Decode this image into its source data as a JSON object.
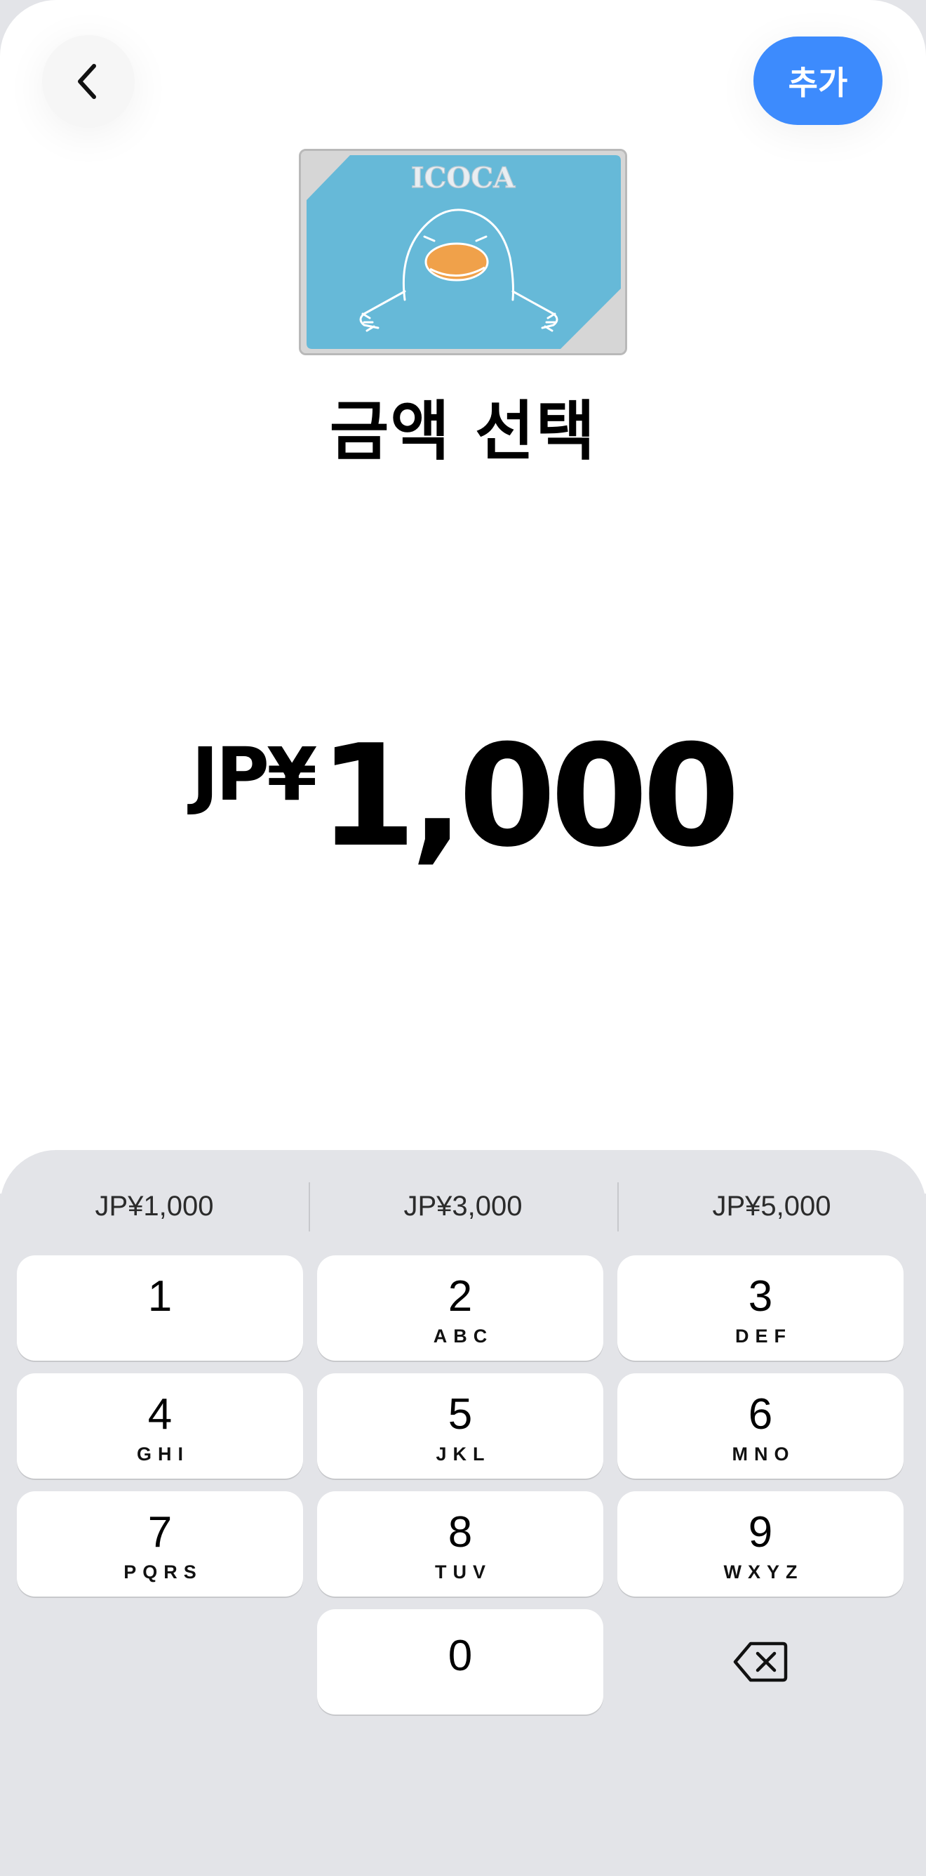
{
  "header": {
    "back_icon": "chevron-left-icon",
    "add_label": "추가",
    "add_color": "#3d8bfd"
  },
  "card": {
    "brand": "ICOCA",
    "color": "#66b9d8",
    "mascot_icon": "platypus-mascot-icon"
  },
  "title": "금액 선택",
  "amount": {
    "currency_prefix": "JP¥",
    "value": "1,000"
  },
  "presets": [
    "JP¥1,000",
    "JP¥3,000",
    "JP¥5,000"
  ],
  "keypad": {
    "keys": [
      {
        "digit": "1",
        "letters": ""
      },
      {
        "digit": "2",
        "letters": "ABC"
      },
      {
        "digit": "3",
        "letters": "DEF"
      },
      {
        "digit": "4",
        "letters": "GHI"
      },
      {
        "digit": "5",
        "letters": "JKL"
      },
      {
        "digit": "6",
        "letters": "MNO"
      },
      {
        "digit": "7",
        "letters": "PQRS"
      },
      {
        "digit": "8",
        "letters": "TUV"
      },
      {
        "digit": "9",
        "letters": "WXYZ"
      },
      {
        "digit": "0",
        "letters": ""
      }
    ],
    "delete_icon": "backspace-icon"
  }
}
